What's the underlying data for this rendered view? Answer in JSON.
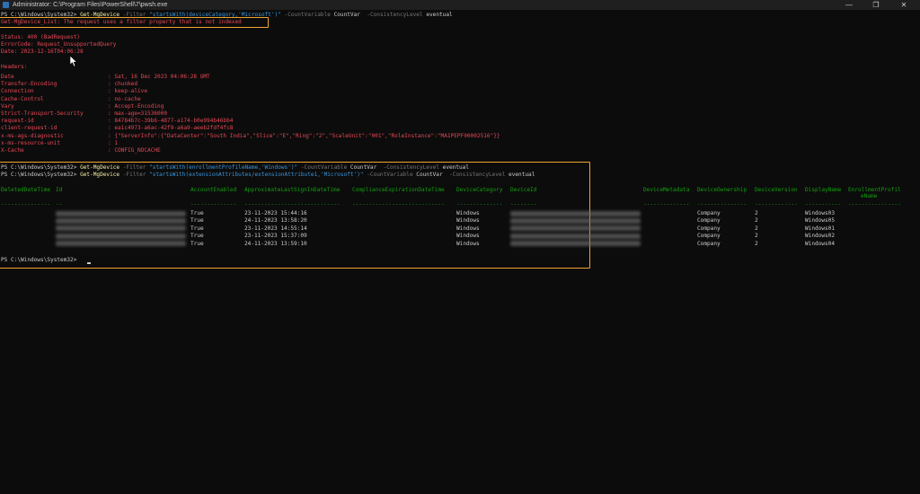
{
  "window": {
    "title": "Administrator: C:\\Program Files\\PowerShell\\7\\pwsh.exe",
    "minimize": "—",
    "maximize": "❐",
    "close": "✕"
  },
  "cmd1": {
    "prompt": "PS C:\\Windows\\System32> ",
    "cmdlet": "Get-MgDevice",
    "p1": " -Filter ",
    "s1": "\"startsWith(deviceCategory,'Microsoft')\"",
    "p2": " -CountVariable ",
    "v2": "CountVar",
    "p3": "  -ConsistencyLevel ",
    "v3": "eventual"
  },
  "error": {
    "message": "Get-MgDevice_List: The request uses a filter property that is not indexed",
    "status": "Status: 400 (BadRequest)",
    "code": "ErrorCode: Request_UnsupportedQuery",
    "date": "Date: 2023-12-16T04:06:28",
    "headers_title": "Headers:",
    "headers": [
      {
        "k": "Date",
        "v": ": Sat, 16 Dec 2023 04:06:28 GMT"
      },
      {
        "k": "Transfer-Encoding",
        "v": ": chunked"
      },
      {
        "k": "Connection",
        "v": ": keep-alive"
      },
      {
        "k": "Cache-Control",
        "v": ": no-cache"
      },
      {
        "k": "Vary",
        "v": ": Accept-Encoding"
      },
      {
        "k": "Strict-Transport-Security",
        "v": ": max-age=31536000"
      },
      {
        "k": "request-id",
        "v": ": 84784b7c-39b6-4877-a174-b0e994b46bb4"
      },
      {
        "k": "client-request-id",
        "v": ": ea1c4973-a6ac-42f9-a6a9-aeeb2fdf4fc8"
      },
      {
        "k": "x-ms-ags-diagnostic",
        "v": ": {\"ServerInfo\":{\"DataCenter\":\"South India\",\"Slice\":\"E\",\"Ring\":\"2\",\"ScaleUnit\":\"001\",\"RoleInstance\":\"MA1PEPF00002516\"}}"
      },
      {
        "k": "x-ms-resource-unit",
        "v": ": 1"
      },
      {
        "k": "X-Cache",
        "v": ": CONFIG_NOCACHE"
      }
    ]
  },
  "cmd2": {
    "prompt": "PS C:\\Windows\\System32> ",
    "cmdlet": "Get-MgDevice",
    "p1": " -Filter ",
    "s1": "\"startsWith(enrollmentProfileName,'Windows')\"",
    "p2": " -CountVariable ",
    "v2": "CountVar",
    "p3": "  -ConsistencyLevel ",
    "v3": "eventual"
  },
  "cmd3": {
    "prompt": "PS C:\\Windows\\System32> ",
    "cmdlet": "Get-MgDevice",
    "p1": " -Filter ",
    "s1": "\"startsWith(extensionAttributes/extensionAttribute1,'Microsoft')\"",
    "p2": " -CountVariable ",
    "v2": "CountVar",
    "p3": "  -ConsistencyLevel ",
    "v3": "eventual"
  },
  "table": {
    "columns": [
      "DeletedDateTime",
      "Id",
      "AccountEnabled",
      "ApproximateLastSignInDateTime",
      "ComplianceExpirationDateTime",
      "DeviceCategory",
      "DeviceId",
      "DeviceMetadata",
      "DeviceOwnership",
      "DeviceVersion",
      "DisplayName",
      "EnrollmentProfil",
      "eName"
    ],
    "separators": {
      "deleted": "---------------",
      "id": "--",
      "account": "--------------",
      "signin": "-----------------------------",
      "compliance": "----------------------------",
      "category": "--------------",
      "deviceid": "--------",
      "metadata": "--------------",
      "ownership": "---------------",
      "version": "-------------",
      "display": "-----------",
      "enroll": "----------------"
    },
    "rows": [
      {
        "enabled": "True",
        "signin": "23-11-2023 15:44:16",
        "category": "Windows",
        "ownership": "Company",
        "version": "2",
        "name": "Windows03"
      },
      {
        "enabled": "True",
        "signin": "24-11-2023 13:58:20",
        "category": "Windows",
        "ownership": "Company",
        "version": "2",
        "name": "Windows05"
      },
      {
        "enabled": "True",
        "signin": "23-11-2023 14:55:14",
        "category": "Windows",
        "ownership": "Company",
        "version": "2",
        "name": "Windows01"
      },
      {
        "enabled": "True",
        "signin": "23-11-2023 15:37:09",
        "category": "Windows",
        "ownership": "Company",
        "version": "2",
        "name": "Windows02"
      },
      {
        "enabled": "True",
        "signin": "24-11-2023 13:59:10",
        "category": "Windows",
        "ownership": "Company",
        "version": "2",
        "name": "Windows04"
      }
    ]
  },
  "final_prompt": "PS C:\\Windows\\System32> ",
  "colors": {
    "highlight": "#f0a430",
    "error": "#e74856",
    "header": "#13a10e",
    "background": "#0c0c0c"
  },
  "icons": {
    "app": "powershell-icon",
    "pointer": "mouse-pointer-icon"
  }
}
